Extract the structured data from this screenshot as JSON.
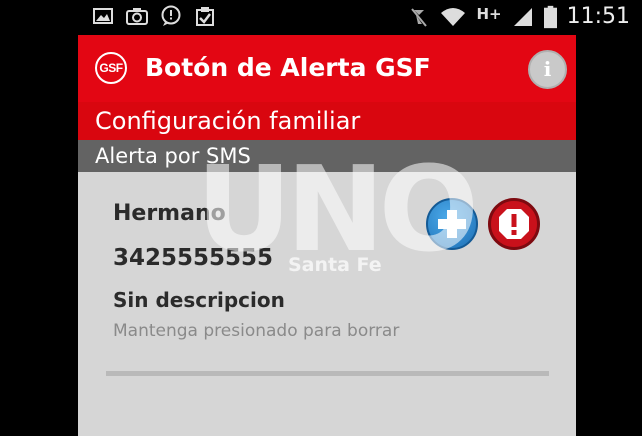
{
  "status_bar": {
    "time": "11:51",
    "network_type": "H+",
    "icons": [
      "image-icon",
      "camera-icon",
      "chat-icon",
      "clipboard-check-icon",
      "muted-icon",
      "wifi-icon",
      "signal-icon",
      "battery-icon"
    ]
  },
  "app": {
    "logo_text": "GSF",
    "title": "Botón de Alerta GSF",
    "info_label": "i",
    "section_title": "Configuración familiar",
    "subsection_title": "Alerta por SMS"
  },
  "contact": {
    "name": "Hermano",
    "phone": "3425555555",
    "description": "Sin descripcion",
    "hint": "Mantenga presionado para borrar"
  },
  "watermark": {
    "brand": "UNO",
    "location": "Santa Fe"
  },
  "colors": {
    "title_red": "#e30613",
    "section_red": "#d9060f",
    "subsection_gray": "#636363",
    "add_blue": "#1d6fb5",
    "alert_red": "#c9111b"
  }
}
